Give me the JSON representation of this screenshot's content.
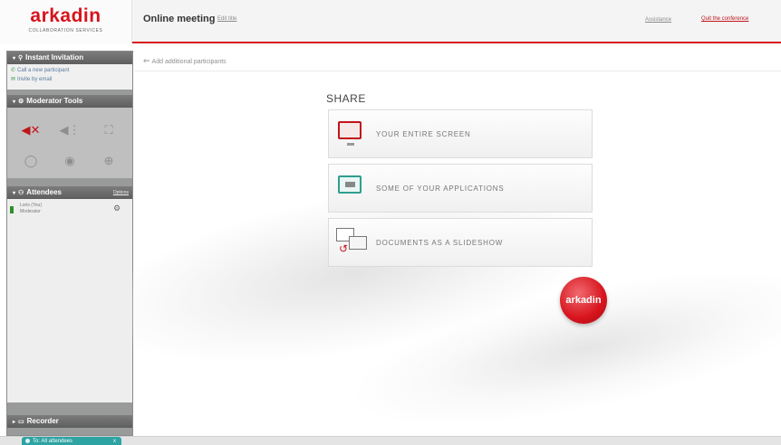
{
  "header": {
    "logo": "arkadin",
    "logo_sub": "COLLABORATION SERVICES",
    "meeting_title": "Online meeting",
    "edit_title": "Edit title",
    "assistance": "Assistance",
    "quit": "Quit the conference"
  },
  "sidebar": {
    "invitation": {
      "title": "Instant Invitation",
      "items": [
        "Call a new participant",
        "Invite by email"
      ]
    },
    "moderator": {
      "title": "Moderator Tools",
      "icons": [
        "mute-all-icon",
        "unmute-all-icon",
        "fullscreen-icon",
        "chat-icon",
        "record-icon",
        "add-icon"
      ]
    },
    "attendees": {
      "title": "Attendees",
      "action": "Options",
      "list": [
        {
          "name": "Loris (You)",
          "role": "Moderator"
        }
      ]
    },
    "recorder": {
      "title": "Recorder"
    }
  },
  "main": {
    "add_participants": "Add additional participants",
    "share_title": "SHARE",
    "options": [
      {
        "label": "YOUR ENTIRE SCREEN",
        "icon": "screen-icon"
      },
      {
        "label": "SOME OF YOUR APPLICATIONS",
        "icon": "application-icon"
      },
      {
        "label": "DOCUMENTS AS A SLIDESHOW",
        "icon": "slideshow-icon"
      }
    ],
    "badge": "arkadin"
  },
  "footer": {
    "tab": "To: All attendees",
    "close": "x"
  },
  "colors": {
    "brand_red": "#d7141d",
    "sidebar_gray": "#999a9a",
    "teal": "#2ea3a3"
  }
}
